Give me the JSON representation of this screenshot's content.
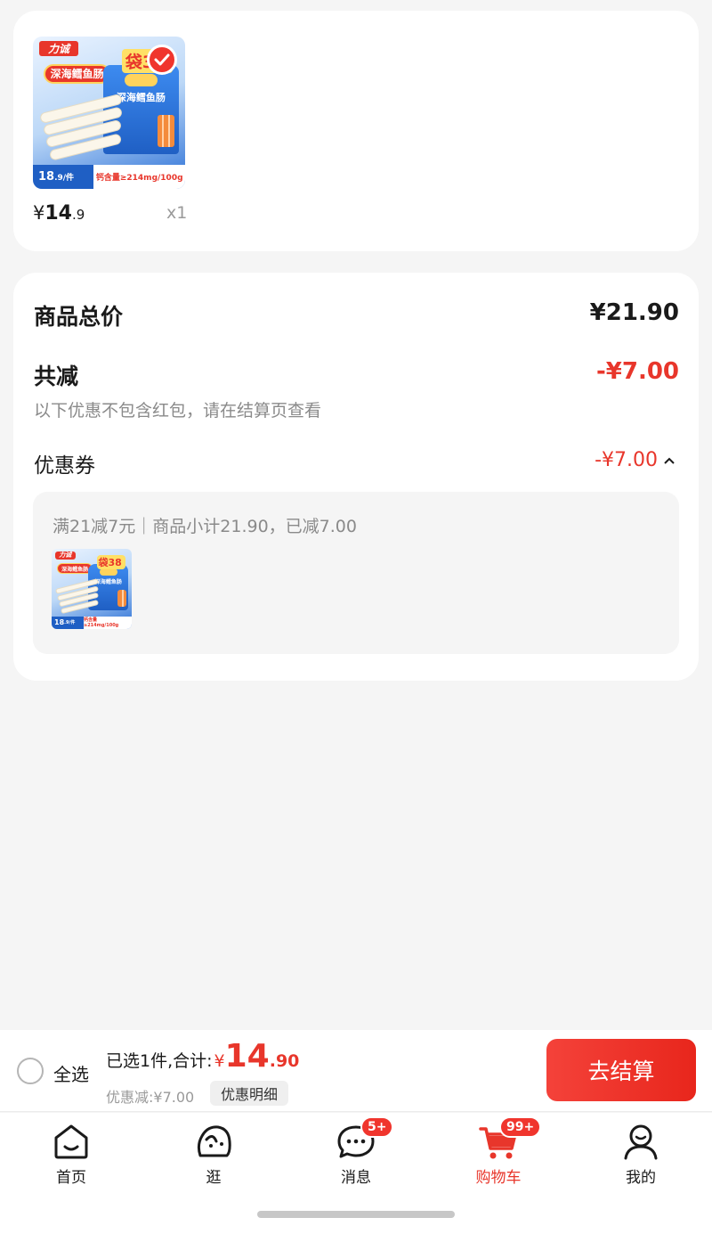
{
  "cart_item": {
    "thumbnail": {
      "brand": "力诚",
      "tag": "深海鳕鱼肠",
      "bag_label": "深海鳕鱼肠",
      "promo": "袋38",
      "unit_price_int": "18",
      "unit_price_dec": ".9/件",
      "calcium": "钙含量≥214mg/100g"
    },
    "price_symbol": "¥",
    "price_int": "14",
    "price_dec": ".9",
    "quantity": "x1"
  },
  "summary": {
    "total_label": "商品总价",
    "total_value": "¥21.90",
    "reduced_label": "共减",
    "reduced_value": "-¥7.00",
    "note": "以下优惠不包含红包，请在结算页查看",
    "coupon_label": "优惠券",
    "coupon_value": "-¥7.00",
    "coupon_desc": "满21减7元｜商品小计21.90，已减7.00"
  },
  "checkout": {
    "select_all": "全选",
    "selected_text": "已选1件,合计:",
    "total_symbol": "¥",
    "total_int": "14",
    "total_dec": ".90",
    "discount_text": "优惠减:¥7.00",
    "detail_button": "优惠明细",
    "pay_button": "去结算"
  },
  "tabs": [
    {
      "label": "首页",
      "icon": "home-icon"
    },
    {
      "label": "逛",
      "icon": "explore-icon"
    },
    {
      "label": "消息",
      "icon": "message-icon",
      "badge": "5+"
    },
    {
      "label": "购物车",
      "icon": "cart-icon",
      "badge": "99+",
      "active": true
    },
    {
      "label": "我的",
      "icon": "profile-icon"
    }
  ],
  "colors": {
    "accent": "#e8362b",
    "background": "#f5f5f5"
  }
}
